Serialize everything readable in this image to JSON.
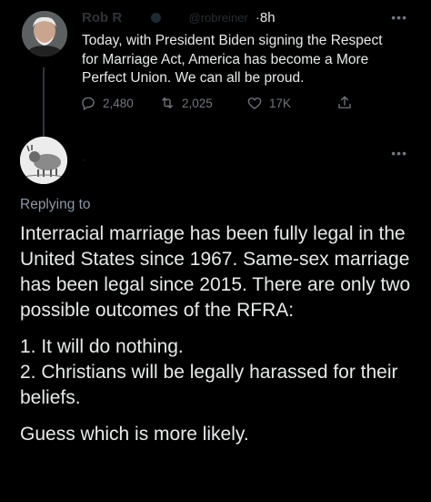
{
  "tweet": {
    "author_name": "Rob R",
    "verified_badge": "verified-badge-icon",
    "handle": "@robreiner",
    "separator": "·",
    "time": "8h",
    "text": "Today, with President Biden signing the Respect for Marriage Act, America has become a More Perfect Union. We can all be proud.",
    "stats": {
      "replies": "2,480",
      "retweets": "2,025",
      "likes": "17K"
    }
  },
  "reply": {
    "author_mark": "·",
    "replying_to": "Replying to",
    "paragraphs": [
      "Interracial marriage has been fully legal in the United States since 1967. Same-sex marriage has been legal since 2015. There are only two possible outcomes of the RFRA:",
      "1. It will do nothing.",
      "2. Christians will be legally harassed for their beliefs.",
      "Guess which is more likely."
    ]
  },
  "colors": {
    "background": "#000000",
    "text": "#e7e9ea",
    "muted": "#71767b",
    "thread_line": "#333639"
  }
}
